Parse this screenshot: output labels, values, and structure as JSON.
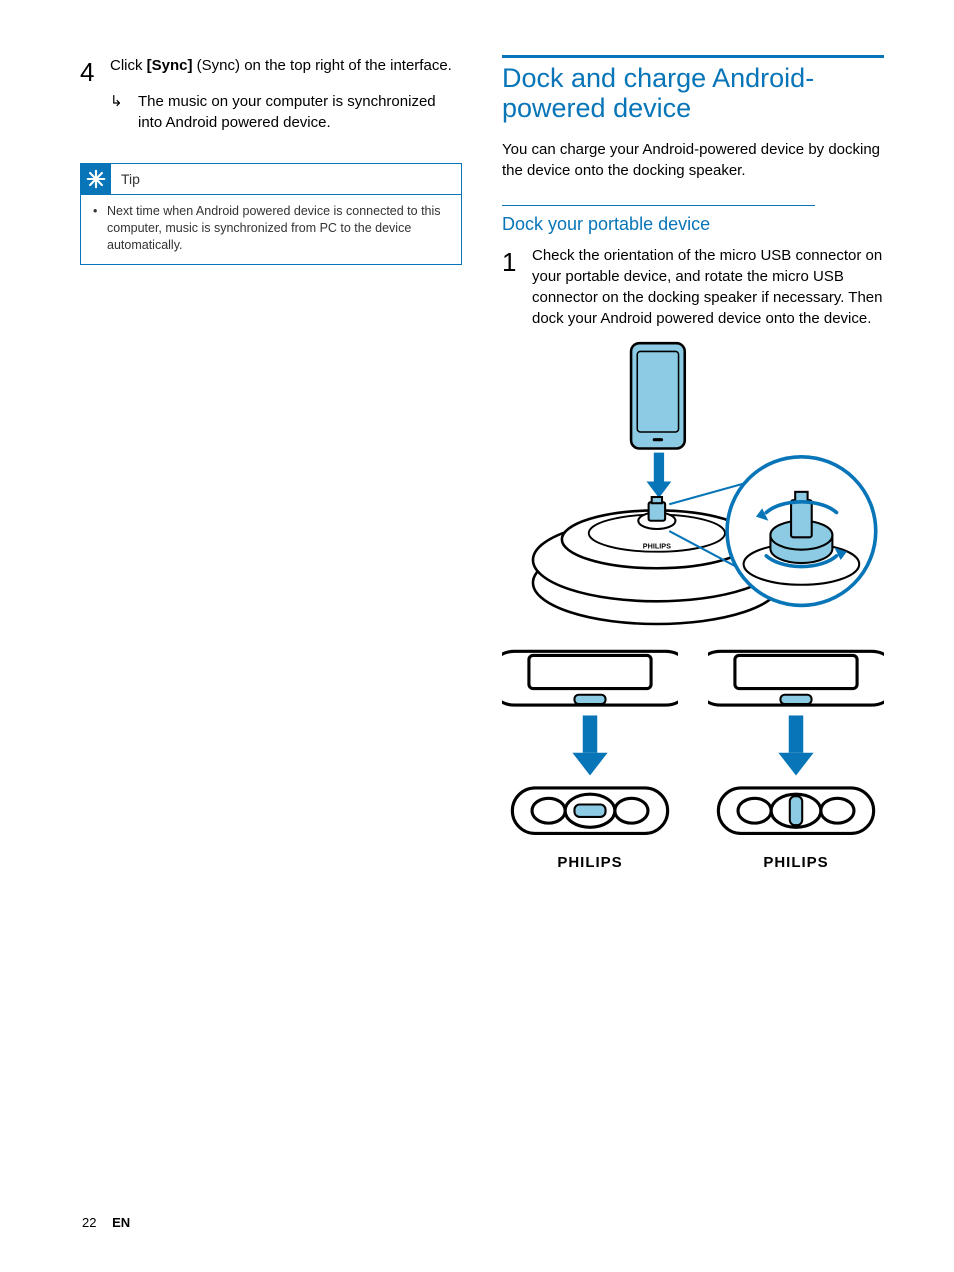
{
  "colors": {
    "brand_blue": "#0875b8",
    "accent_fill": "#8dcbe4"
  },
  "left": {
    "step": {
      "num": "4",
      "pre": "Click ",
      "bold1": "[Sync]",
      "post": " (Sync) on the top right of the interface."
    },
    "result": {
      "arrow": "↳",
      "text": "The music on your computer is synchronized into Android powered device."
    },
    "tip": {
      "label": "Tip",
      "body": "Next time when Android powered device is connected to this computer, music is synchronized from PC to the device automatically."
    }
  },
  "right": {
    "heading": "Dock and charge Android-powered device",
    "intro": "You can charge your Android-powered device by docking the device onto the docking speaker.",
    "subheading": "Dock your portable device",
    "step": {
      "num": "1",
      "text": "Check the orientation of the micro USB connector on your portable device, and rotate the micro USB connector on the docking speaker if necessary. Then dock your Android powered device onto the device."
    },
    "brand_label": "PHILIPS"
  },
  "footer": {
    "page_number": "22",
    "language": "EN"
  }
}
